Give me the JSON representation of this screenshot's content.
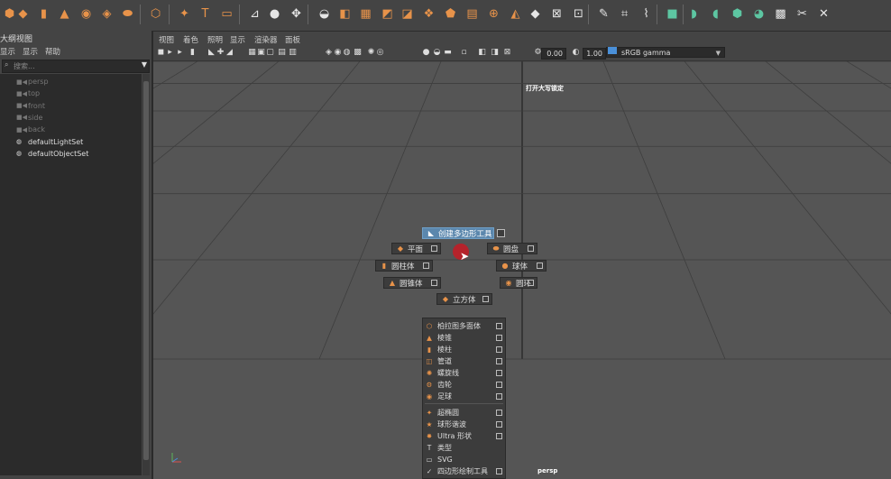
{
  "shelf": {
    "icons": [
      {
        "name": "polygon-sphere-icon",
        "glyph": "⬢",
        "color": "orange"
      },
      {
        "name": "polygon-cube-icon",
        "glyph": "◆",
        "color": "orange"
      },
      {
        "name": "polygon-cylinder-icon",
        "glyph": "▮",
        "color": "orange"
      },
      {
        "name": "polygon-cone-icon",
        "glyph": "▲",
        "color": "orange"
      },
      {
        "name": "polygon-torus-icon",
        "glyph": "◉",
        "color": "orange"
      },
      {
        "name": "polygon-plane-icon",
        "glyph": "◈",
        "color": "orange"
      },
      {
        "name": "polygon-disc-icon",
        "glyph": "⬬",
        "color": "orange"
      },
      {
        "name": "platonic-solid-icon",
        "glyph": "⬡",
        "color": "orange"
      },
      {
        "name": "super-shape-icon",
        "glyph": "✦",
        "color": "orange"
      },
      {
        "name": "type-tool-icon",
        "glyph": "T",
        "color": "orange"
      },
      {
        "name": "svg-tool-icon",
        "glyph": "▭",
        "color": "orange"
      },
      {
        "name": "measure-tool-icon",
        "glyph": "⊿",
        "color": "white"
      },
      {
        "name": "snap-icon",
        "glyph": "●",
        "color": "white"
      },
      {
        "name": "freeze-transform-icon",
        "glyph": "✥",
        "color": "white"
      },
      {
        "name": "combine-icon",
        "glyph": "◒",
        "color": "white"
      },
      {
        "name": "separate-icon",
        "glyph": "◧",
        "color": "orange"
      },
      {
        "name": "smooth-icon",
        "glyph": "▦",
        "color": "orange"
      },
      {
        "name": "boolean-icon",
        "glyph": "◩",
        "color": "orange"
      },
      {
        "name": "mirror-icon",
        "glyph": "◪",
        "color": "orange"
      },
      {
        "name": "extrude-icon",
        "glyph": "❖",
        "color": "orange"
      },
      {
        "name": "bevel-icon",
        "glyph": "⬟",
        "color": "orange"
      },
      {
        "name": "bridge-icon",
        "glyph": "▤",
        "color": "orange"
      },
      {
        "name": "append-polygon-icon",
        "glyph": "⊕",
        "color": "orange"
      },
      {
        "name": "fill-hole-icon",
        "glyph": "◭",
        "color": "orange"
      },
      {
        "name": "merge-icon",
        "glyph": "◆",
        "color": "white"
      },
      {
        "name": "collapse-icon",
        "glyph": "⊠",
        "color": "white"
      },
      {
        "name": "target-weld-icon",
        "glyph": "⊡",
        "color": "white"
      },
      {
        "name": "multi-cut-icon",
        "glyph": "✎",
        "color": "white"
      },
      {
        "name": "insert-edge-loop-icon",
        "glyph": "⌗",
        "color": "white"
      },
      {
        "name": "offset-edge-loop-icon",
        "glyph": "⌇",
        "color": "white"
      },
      {
        "name": "planar-uv-icon",
        "glyph": "■",
        "color": "green"
      },
      {
        "name": "cylindrical-uv-icon",
        "glyph": "◗",
        "color": "green"
      },
      {
        "name": "spherical-uv-icon",
        "glyph": "◖",
        "color": "green"
      },
      {
        "name": "auto-uv-icon",
        "glyph": "⬢",
        "color": "green"
      },
      {
        "name": "camera-based-uv-icon",
        "glyph": "◕",
        "color": "green"
      },
      {
        "name": "uv-editor-icon",
        "glyph": "▩",
        "color": "white"
      },
      {
        "name": "cut-uv-icon",
        "glyph": "✂",
        "color": "white"
      },
      {
        "name": "sew-uv-icon",
        "glyph": "✕",
        "color": "white"
      }
    ]
  },
  "outliner": {
    "title": "大纲视图",
    "menu": [
      "显示",
      "显示",
      "帮助"
    ],
    "search_placeholder": "搜索...",
    "items": [
      {
        "label": "persp",
        "icon": "■◀",
        "type": "camera"
      },
      {
        "label": "top",
        "icon": "■◀",
        "type": "camera"
      },
      {
        "label": "front",
        "icon": "■◀",
        "type": "camera"
      },
      {
        "label": "side",
        "icon": "■◀",
        "type": "camera"
      },
      {
        "label": "back",
        "icon": "■◀",
        "type": "camera"
      },
      {
        "label": "defaultLightSet",
        "icon": "◍",
        "type": "set"
      },
      {
        "label": "defaultObjectSet",
        "icon": "◍",
        "type": "set"
      }
    ]
  },
  "viewport": {
    "menu": [
      "视图",
      "着色",
      "照明",
      "显示",
      "渲染器",
      "面板"
    ],
    "exposure_value": "0.00",
    "gamma_value": "1.00",
    "color_space": "sRGB gamma",
    "caps_lock_notice": "打开大写锁定",
    "camera_label": "persp"
  },
  "marking_menu": {
    "north": "创建多边形工具",
    "north_west": "平面",
    "north_east": "圆盘",
    "west": "圆柱体",
    "east": "球体",
    "south_west": "圆锥体",
    "south_east": "圆环",
    "south": "立方体"
  },
  "overflow_menu": {
    "items": [
      {
        "label": "柏拉图多面体",
        "icon": "⬡"
      },
      {
        "label": "棱锥",
        "icon": "▲"
      },
      {
        "label": "棱柱",
        "icon": "▮"
      },
      {
        "label": "管道",
        "icon": "◫"
      },
      {
        "label": "螺旋线",
        "icon": "✺"
      },
      {
        "label": "齿轮",
        "icon": "⚙"
      },
      {
        "label": "足球",
        "icon": "◉"
      },
      {
        "label": "超椭圆",
        "icon": "✦"
      },
      {
        "label": "球形谐波",
        "icon": "★"
      },
      {
        "label": "Ultra 形状",
        "icon": "✸"
      },
      {
        "label": "类型",
        "icon": "T"
      },
      {
        "label": "SVG",
        "icon": "▭"
      },
      {
        "label": "四边形绘制工具",
        "icon": "✓"
      }
    ]
  }
}
